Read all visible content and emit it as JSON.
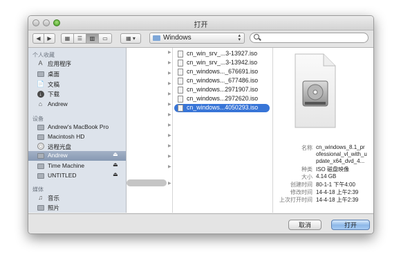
{
  "window": {
    "title": "打开"
  },
  "toolbar": {
    "back_icon": "chevron-left-icon",
    "forward_icon": "chevron-right-icon",
    "view_modes": [
      "icon-view",
      "list-view",
      "column-view",
      "cover-flow-view"
    ],
    "active_view": "column-view",
    "arrange_icon": "grid-icon",
    "location": "Windows",
    "search_placeholder": ""
  },
  "sidebar": {
    "sections": [
      {
        "label": "个人收藏",
        "items": [
          {
            "label": "应用程序",
            "icon": "applications-icon"
          },
          {
            "label": "桌面",
            "icon": "desktop-icon"
          },
          {
            "label": "文稿",
            "icon": "documents-icon"
          },
          {
            "label": "下载",
            "icon": "downloads-icon"
          },
          {
            "label": "Andrew",
            "icon": "home-icon"
          }
        ]
      },
      {
        "label": "设备",
        "items": [
          {
            "label": "Andrew's MacBook Pro",
            "icon": "laptop-icon"
          },
          {
            "label": "Macintosh HD",
            "icon": "hard-drive-icon"
          },
          {
            "label": "远程光盘",
            "icon": "remote-disc-icon"
          },
          {
            "label": "Andrew",
            "icon": "drive-icon",
            "selected": true,
            "eject": true
          },
          {
            "label": "Time Machine",
            "icon": "time-machine-icon",
            "eject": true
          },
          {
            "label": "UNTITLED",
            "icon": "drive-icon",
            "eject": true
          }
        ]
      },
      {
        "label": "媒体",
        "items": [
          {
            "label": "音乐",
            "icon": "music-icon"
          },
          {
            "label": "照片",
            "icon": "photos-icon"
          }
        ]
      }
    ]
  },
  "files": [
    {
      "name": "cn_win_srv_...3-13927.iso"
    },
    {
      "name": "cn_win_srv_...3-13942.iso"
    },
    {
      "name": "cn_windows..._676691.iso"
    },
    {
      "name": "cn_windows..._677486.iso"
    },
    {
      "name": "cn_windows...2971907.iso"
    },
    {
      "name": "cn_windows...2972620.iso"
    },
    {
      "name": "cn_windows...4050293.iso",
      "selected": true
    }
  ],
  "preview": {
    "name_label": "名称",
    "name_value": [
      "cn_windows_8.1_pr",
      "ofessional_vl_with_u",
      "pdate_x64_dvd_4..."
    ],
    "kind_label": "种类",
    "kind_value": "ISO 磁盘映像",
    "size_label": "大小",
    "size_value": "4.14 GB",
    "created_label": "创建时间",
    "created_value": "80-1-1 下午4:00",
    "modified_label": "修改时间",
    "modified_value": "14-4-18 上午2:39",
    "opened_label": "上次打开时间",
    "opened_value": "14-4-18 上午2:39"
  },
  "buttons": {
    "cancel": "取消",
    "open": "打开"
  }
}
